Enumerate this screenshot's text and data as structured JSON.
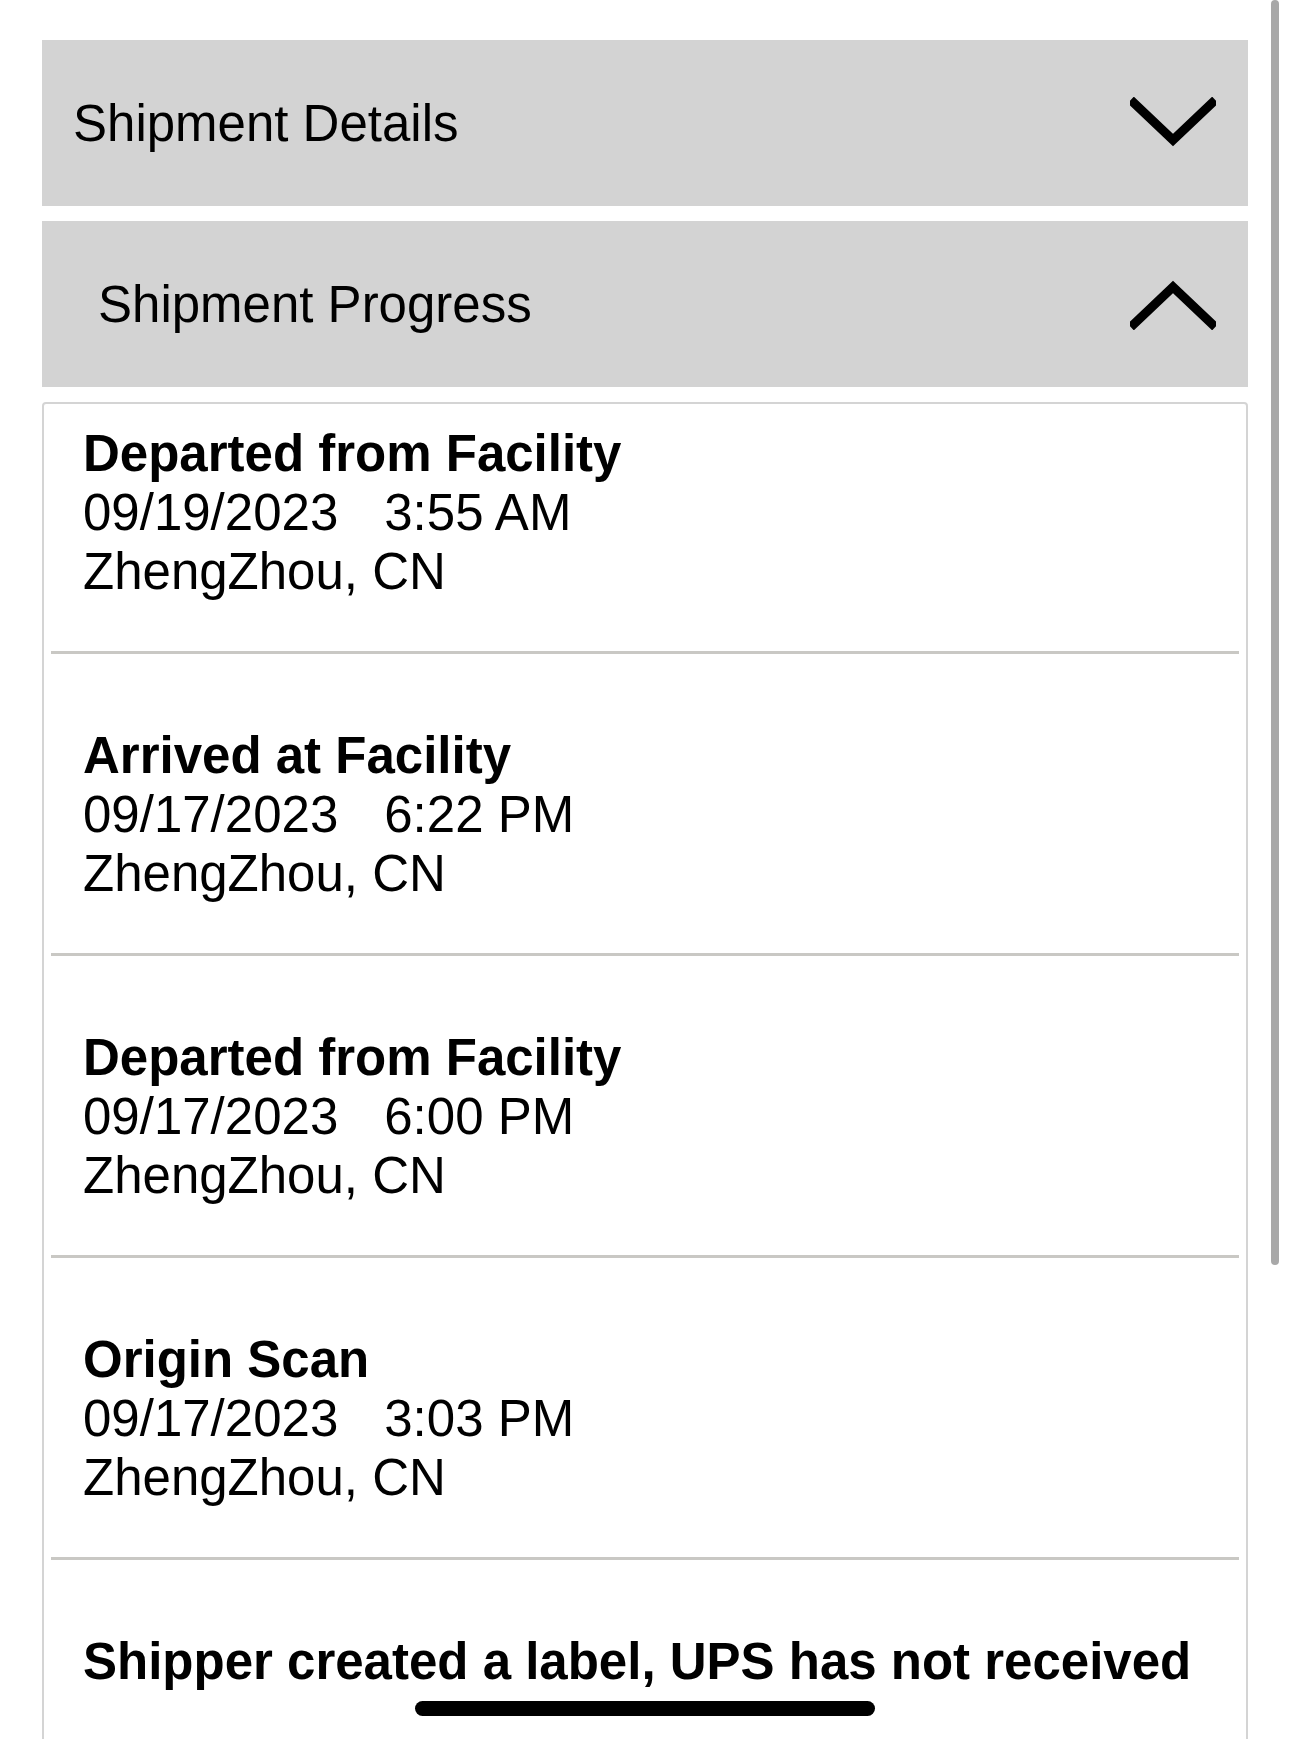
{
  "sections": [
    {
      "title": "Shipment Details",
      "expanded": false
    },
    {
      "title": "Shipment Progress",
      "expanded": true,
      "events": [
        {
          "status": "Departed from Facility",
          "date": "09/19/2023",
          "time": "3:55 AM",
          "location": "ZhengZhou, CN"
        },
        {
          "status": "Arrived at Facility",
          "date": "09/17/2023",
          "time": "6:22 PM",
          "location": "ZhengZhou, CN"
        },
        {
          "status": "Departed from Facility",
          "date": "09/17/2023",
          "time": "6:00 PM",
          "location": "ZhengZhou, CN"
        },
        {
          "status": "Origin Scan",
          "date": "09/17/2023",
          "time": "3:03 PM",
          "location": "ZhengZhou, CN"
        },
        {
          "status": "Shipper created a label, UPS has not received"
        }
      ]
    }
  ]
}
